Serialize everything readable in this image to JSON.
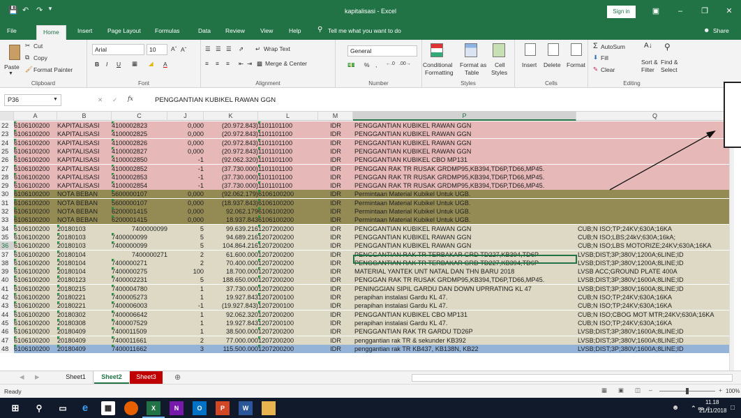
{
  "window": {
    "title": "kapitalisasi  -  Excel",
    "sign_in": "Sign in"
  },
  "ribbon_tabs": [
    "File",
    "Home",
    "Insert",
    "Page Layout",
    "Formulas",
    "Data",
    "Review",
    "View",
    "Help"
  ],
  "tell_me": "Tell me what you want to do",
  "share": "Share",
  "clipboard": {
    "paste": "Paste",
    "cut": "Cut",
    "copy": "Copy",
    "format_painter": "Format Painter",
    "label": "Clipboard"
  },
  "font": {
    "name": "Arial",
    "size": "10",
    "label": "Font"
  },
  "alignment": {
    "wrap": "Wrap Text",
    "merge": "Merge & Center",
    "label": "Alignment"
  },
  "number": {
    "format": "General",
    "label": "Number"
  },
  "styles": {
    "conditional": "Conditional",
    "conditional2": "Formatting",
    "format_as": "Format as",
    "format_as2": "Table",
    "cell": "Cell",
    "cell2": "Styles",
    "label": "Styles"
  },
  "cells": {
    "insert": "Insert",
    "delete": "Delete",
    "format": "Format",
    "label": "Cells"
  },
  "editing": {
    "autosum": "AutoSum",
    "fill": "Fill",
    "clear": "Clear",
    "sort": "Sort &",
    "sort2": "Filter",
    "find": "Find &",
    "find2": "Select",
    "label": "Editing"
  },
  "formula_bar": {
    "name_box": "P36",
    "fx": "fx",
    "content": "PENGGANTIAN KUBIKEL RAWAN GGN"
  },
  "columns": [
    "A",
    "B",
    "C",
    "J",
    "K",
    "L",
    "M",
    "P",
    "Q"
  ],
  "rows": [
    {
      "n": "22",
      "a": "6106100200",
      "b": "KAPITALISASI",
      "c": "4100002823",
      "j": "0,000",
      "k": "(20.972.843)",
      "l": "1101101100",
      "m": "IDR",
      "p": "PENGGANTIAN KUBIKEL RAWAN GGN",
      "q": ""
    },
    {
      "n": "23",
      "a": "6106100200",
      "b": "KAPITALISASI",
      "c": "4100002825",
      "j": "0,000",
      "k": "(20.972.843)",
      "l": "1101101100",
      "m": "IDR",
      "p": "PENGGANTIAN KUBIKEL RAWAN GGN",
      "q": ""
    },
    {
      "n": "24",
      "a": "6106100200",
      "b": "KAPITALISASI",
      "c": "4100002826",
      "j": "0,000",
      "k": "(20.972.843)",
      "l": "1101101100",
      "m": "IDR",
      "p": "PENGGANTIAN KUBIKEL RAWAN GGN",
      "q": ""
    },
    {
      "n": "25",
      "a": "6106100200",
      "b": "KAPITALISASI",
      "c": "4100002827",
      "j": "0,000",
      "k": "(20.972.843)",
      "l": "1101101100",
      "m": "IDR",
      "p": "PENGGANTIAN KUBIKEL RAWAN GGN",
      "q": ""
    },
    {
      "n": "26",
      "a": "6106100200",
      "b": "KAPITALISASI",
      "c": "4100002850",
      "j": "-1",
      "k": "(92.062.320)",
      "l": "1101101100",
      "m": "IDR",
      "p": "PENGGANTIAN KUBIKEL CBO  MP131",
      "q": ""
    },
    {
      "n": "27",
      "a": "6106100200",
      "b": "KAPITALISASI",
      "c": "4100002852",
      "j": "-1",
      "k": "(37.730.000)",
      "l": "1101101100",
      "m": "IDR",
      "p": "PENGGAN RAK TR RUSAK GRDMP95,KB394,TD6P,TD66,MP45.",
      "q": ""
    },
    {
      "n": "28",
      "a": "6106100200",
      "b": "KAPITALISASI",
      "c": "4100002853",
      "j": "-1",
      "k": "(37.730.000)",
      "l": "1101101100",
      "m": "IDR",
      "p": "PENGGAN RAK TR RUSAK GRDMP95,KB394,TD6P,TD66,MP45.",
      "q": ""
    },
    {
      "n": "29",
      "a": "6106100200",
      "b": "KAPITALISASI",
      "c": "4100002854",
      "j": "-1",
      "k": "(37.730.000)",
      "l": "1101101100",
      "m": "IDR",
      "p": "PENGGAN RAK TR RUSAK GRDMP95,KB394,TD6P,TD66,MP45.",
      "q": ""
    },
    {
      "n": "30",
      "a": "6106100200",
      "b": "NOTA BEBAN",
      "c": "5600000107",
      "j": "0,000",
      "k": "(92.062.179)",
      "l": "6106100200",
      "m": "IDR",
      "p": "Permintaan Material Kubikel Untuk UGB.",
      "q": ""
    },
    {
      "n": "31",
      "a": "6106100200",
      "b": "NOTA BEBAN",
      "c": "5600000107",
      "j": "0,000",
      "k": "(18.937.843)",
      "l": "6106100200",
      "m": "IDR",
      "p": "Permintaan Material Kubikel Untuk UGB.",
      "q": ""
    },
    {
      "n": "32",
      "a": "6106100200",
      "b": "NOTA BEBAN",
      "c": "6200001415",
      "j": "0,000",
      "k": "92.062.179",
      "l": "6106100200",
      "m": "IDR",
      "p": "Permintaan Material Kubikel Untuk UGB.",
      "q": ""
    },
    {
      "n": "33",
      "a": "6106100200",
      "b": "NOTA BEBAN",
      "c": "6200001415",
      "j": "0,000",
      "k": "18.937.843",
      "l": "6106100200",
      "m": "IDR",
      "p": "Permintaan Material Kubikel Untuk UGB.",
      "q": ""
    },
    {
      "n": "34",
      "a": "6106100200",
      "b": "20180103",
      "c": "7400000099",
      "j": "5",
      "k": "99.639.216",
      "l": "1207200200",
      "m": "IDR",
      "p": "PENGGANTIAN KUBIKEL RAWAN GGN",
      "q": "CUB;N ISO;TP;24KV;630A;16KA"
    },
    {
      "n": "35",
      "a": "6106100200",
      "b": "20180103",
      "c": "7400000099",
      "j": "5",
      "k": "94.689.216",
      "l": "1207200200",
      "m": "IDR",
      "p": "PENGGANTIAN KUBIKEL RAWAN GGN",
      "q": "CUB;N ISO;LBS;24kV;630A;16kA;"
    },
    {
      "n": "36",
      "a": "6106100200",
      "b": "20180103",
      "c": "7400000099",
      "j": "5",
      "k": "104.864.216",
      "l": "1207200200",
      "m": "IDR",
      "p": "PENGGANTIAN KUBIKEL RAWAN GGN",
      "q": "CUB;N ISO;LBS MOTORIZE;24KV;630A;16KA"
    },
    {
      "n": "37",
      "a": "6106100200",
      "b": "20180104",
      "c": "7400000271",
      "j": "2",
      "k": "61.600.000",
      "l": "1207200200",
      "m": "IDR",
      "p": "PENGGANTIAN RAK TR TERBAKAR GRD TD227,KB394,TD6P",
      "q": "LVSB;DIST;3P;380V;1200A;6LINE;ID"
    },
    {
      "n": "38",
      "a": "6106100200",
      "b": "20180104",
      "c": "7400000271",
      "j": "2",
      "k": "70.400.000",
      "l": "1207200200",
      "m": "IDR",
      "p": "PENGGANTIAN RAK TR TERBAKAR GRD TD227,KB394,TD6P",
      "q": "LVSB;DIST;3P;380V;1200A;8LINE;ID"
    },
    {
      "n": "39",
      "a": "6106100200",
      "b": "20180104",
      "c": "7400000275",
      "j": "100",
      "k": "18.700.000",
      "l": "1207200200",
      "m": "IDR",
      "p": "MATERIAL YANTEK UNT NATAL DAN THN BARU 2018",
      "q": "LVSB ACC;GROUND PLATE 400A"
    },
    {
      "n": "40",
      "a": "6106100200",
      "b": "20180123",
      "c": "7400002231",
      "j": "5",
      "k": "188.650.000",
      "l": "1207200200",
      "m": "IDR",
      "p": "PENGGAN RAK TR RUSAK GRDMP95,KB394,TD6P,TD66,MP45.",
      "q": "LVSB;DIST;3P;380V;1600A;8LINE;ID"
    },
    {
      "n": "41",
      "a": "6106100200",
      "b": "20180215",
      "c": "7400004780",
      "j": "1",
      "k": "37.730.000",
      "l": "1207200200",
      "m": "IDR",
      "p": "PENINGGIAN SIPIL GARDU DAN DOWN UPRRATING KL 47",
      "q": "LVSB;DIST;3P;380V;1600A;8LINE;ID"
    },
    {
      "n": "42",
      "a": "6106100200",
      "b": "20180221",
      "c": "7400005273",
      "j": "1",
      "k": "19.927.843",
      "l": "1207200100",
      "m": "IDR",
      "p": "perapihan instalasi Gardu KL 47.",
      "q": "CUB;N ISO;TP;24KV;630A;16KA"
    },
    {
      "n": "43",
      "a": "6106100200",
      "b": "20180221",
      "c": "7400006003",
      "j": "-1",
      "k": "(19.927.843)",
      "l": "1207200100",
      "m": "IDR",
      "p": "perapihan instalasi Gardu KL 47.",
      "q": "CUB;N ISO;TP;24KV;630A;16KA"
    },
    {
      "n": "44",
      "a": "6106100200",
      "b": "20180302",
      "c": "7400006642",
      "j": "1",
      "k": "92.062.320",
      "l": "1207200200",
      "m": "IDR",
      "p": "PENGGANTIAN KUBIKEL CBO  MP131",
      "q": "CUB;N ISO;CBOG MOT MTR;24KV;630A;16KA"
    },
    {
      "n": "45",
      "a": "6106100200",
      "b": "20180308",
      "c": "7400007529",
      "j": "1",
      "k": "19.927.843",
      "l": "1207200100",
      "m": "IDR",
      "p": "perapihan instalasi Gardu KL 47.",
      "q": "CUB;N ISO;TP;24KV;630A;16KA"
    },
    {
      "n": "46",
      "a": "6106100200",
      "b": "20180409",
      "c": "7400011509",
      "j": "1",
      "k": "38.500.000",
      "l": "1207200200",
      "m": "IDR",
      "p": "PENGGANTIAN RAK TR GARDU TD26P",
      "q": "LVSB;DIST;3P;380V;1600A;8LINE;ID"
    },
    {
      "n": "47",
      "a": "6106100200",
      "b": "20180409",
      "c": "7400011661",
      "j": "2",
      "k": "77.000.000",
      "l": "1207200200",
      "m": "IDR",
      "p": "penggantian rak TR & sekunder KB392",
      "q": "LVSB;DIST;3P;380V;1600A;8LINE;ID"
    },
    {
      "n": "48",
      "a": "6106100200",
      "b": "20180409",
      "c": "7400011662",
      "j": "3",
      "k": "115.500.000",
      "l": "1207200200",
      "m": "IDR",
      "p": "penggantian rak TR KB437, KB138N, KB22",
      "q": "LVSB;DIST;3P;380V;1600A;8LINE;ID"
    }
  ],
  "sheets": [
    "Sheet1",
    "Sheet2",
    "Sheet3"
  ],
  "status": {
    "ready": "Ready",
    "zoom": "100%"
  },
  "taskbar": {
    "time": "11.18",
    "date": "21/11/2018"
  },
  "colors": {
    "excel_green": "#217346",
    "pink": "#e6b8b7",
    "olive": "#948a54",
    "tan": "#ddd9c4",
    "blue": "#95b3d7"
  }
}
